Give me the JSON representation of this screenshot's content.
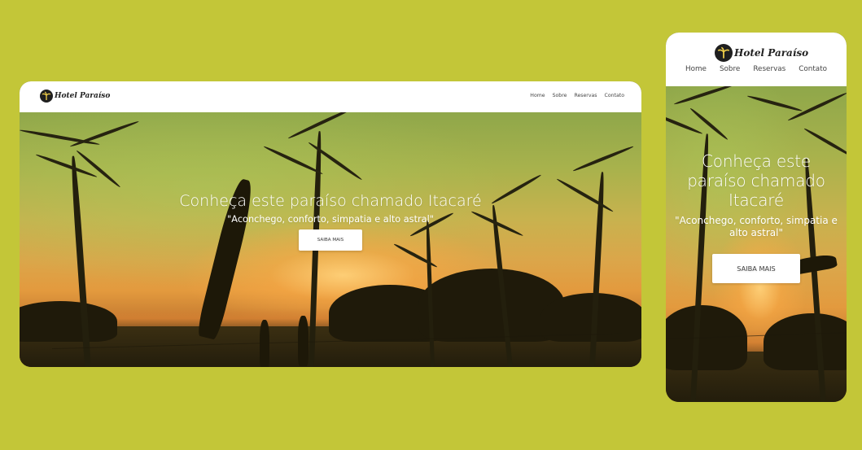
{
  "brand": {
    "name": "Hotel Paraíso"
  },
  "nav": {
    "items": [
      "Home",
      "Sobre",
      "Reservas",
      "Contato"
    ]
  },
  "hero": {
    "title": "Conheça este paraíso chamado Itacaré",
    "subtitle": "\"Aconchego, conforto, simpatia e alto astral\"",
    "cta_label": "SAIBA MAIS"
  },
  "colors": {
    "page_background": "#c3c638",
    "header_background": "#ffffff",
    "hero_text": "#ffffff",
    "button_background": "#ffffff"
  }
}
